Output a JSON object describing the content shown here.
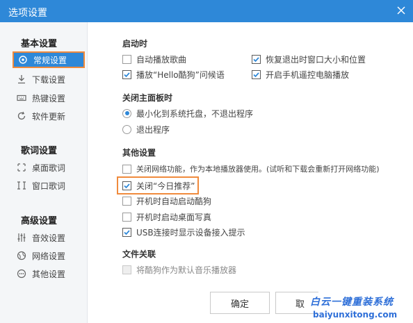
{
  "window": {
    "title": "选项设置"
  },
  "sidebar": {
    "groups": [
      {
        "heading": "基本设置",
        "items": [
          {
            "label": "常规设置",
            "icon": "gear-icon",
            "active": true
          },
          {
            "label": "下载设置",
            "icon": "download-icon"
          },
          {
            "label": "热键设置",
            "icon": "keyboard-icon"
          },
          {
            "label": "软件更新",
            "icon": "refresh-icon"
          }
        ]
      },
      {
        "heading": "歌词设置",
        "items": [
          {
            "label": "桌面歌词",
            "icon": "desktop-lyrics-icon"
          },
          {
            "label": "窗口歌词",
            "icon": "window-lyrics-icon"
          }
        ]
      },
      {
        "heading": "高级设置",
        "items": [
          {
            "label": "音效设置",
            "icon": "equalizer-icon"
          },
          {
            "label": "网络设置",
            "icon": "globe-icon"
          },
          {
            "label": "其他设置",
            "icon": "more-icon"
          }
        ]
      }
    ]
  },
  "startup": {
    "heading": "启动时",
    "options": [
      {
        "label": "自动播放歌曲",
        "checked": false
      },
      {
        "label": "恢复退出时窗口大小和位置",
        "checked": true
      },
      {
        "label": "播放“Hello酷狗”问候语",
        "checked": true
      },
      {
        "label": "开启手机遥控电脑播放",
        "checked": true
      }
    ]
  },
  "close_panel": {
    "heading": "关闭主面板时",
    "options": [
      {
        "label": "最小化到系统托盘，不退出程序",
        "selected": true
      },
      {
        "label": "退出程序",
        "selected": false
      }
    ]
  },
  "other": {
    "heading": "其他设置",
    "options": [
      {
        "label": "关闭网络功能，作为本地播放器使用。(试听和下载会重新打开网络功能)",
        "checked": false
      },
      {
        "label": "关闭“今日推荐”",
        "checked": true
      },
      {
        "label": "开机时自动启动酷狗",
        "checked": false
      },
      {
        "label": "开机时启动桌面写真",
        "checked": false
      },
      {
        "label": "USB连接时显示设备接入提示",
        "checked": true
      }
    ]
  },
  "file_assoc": {
    "heading": "文件关联",
    "option": {
      "label": "将酷狗作为默认音乐播放器",
      "checked": false,
      "disabled": true
    }
  },
  "buttons": {
    "ok": "确定",
    "cancel": "取"
  },
  "watermark": {
    "line1": "白云一键重装系统",
    "line2": "baiyunxitong.com"
  },
  "colors": {
    "accent": "#2e88d8",
    "highlight": "#f08a3c"
  }
}
